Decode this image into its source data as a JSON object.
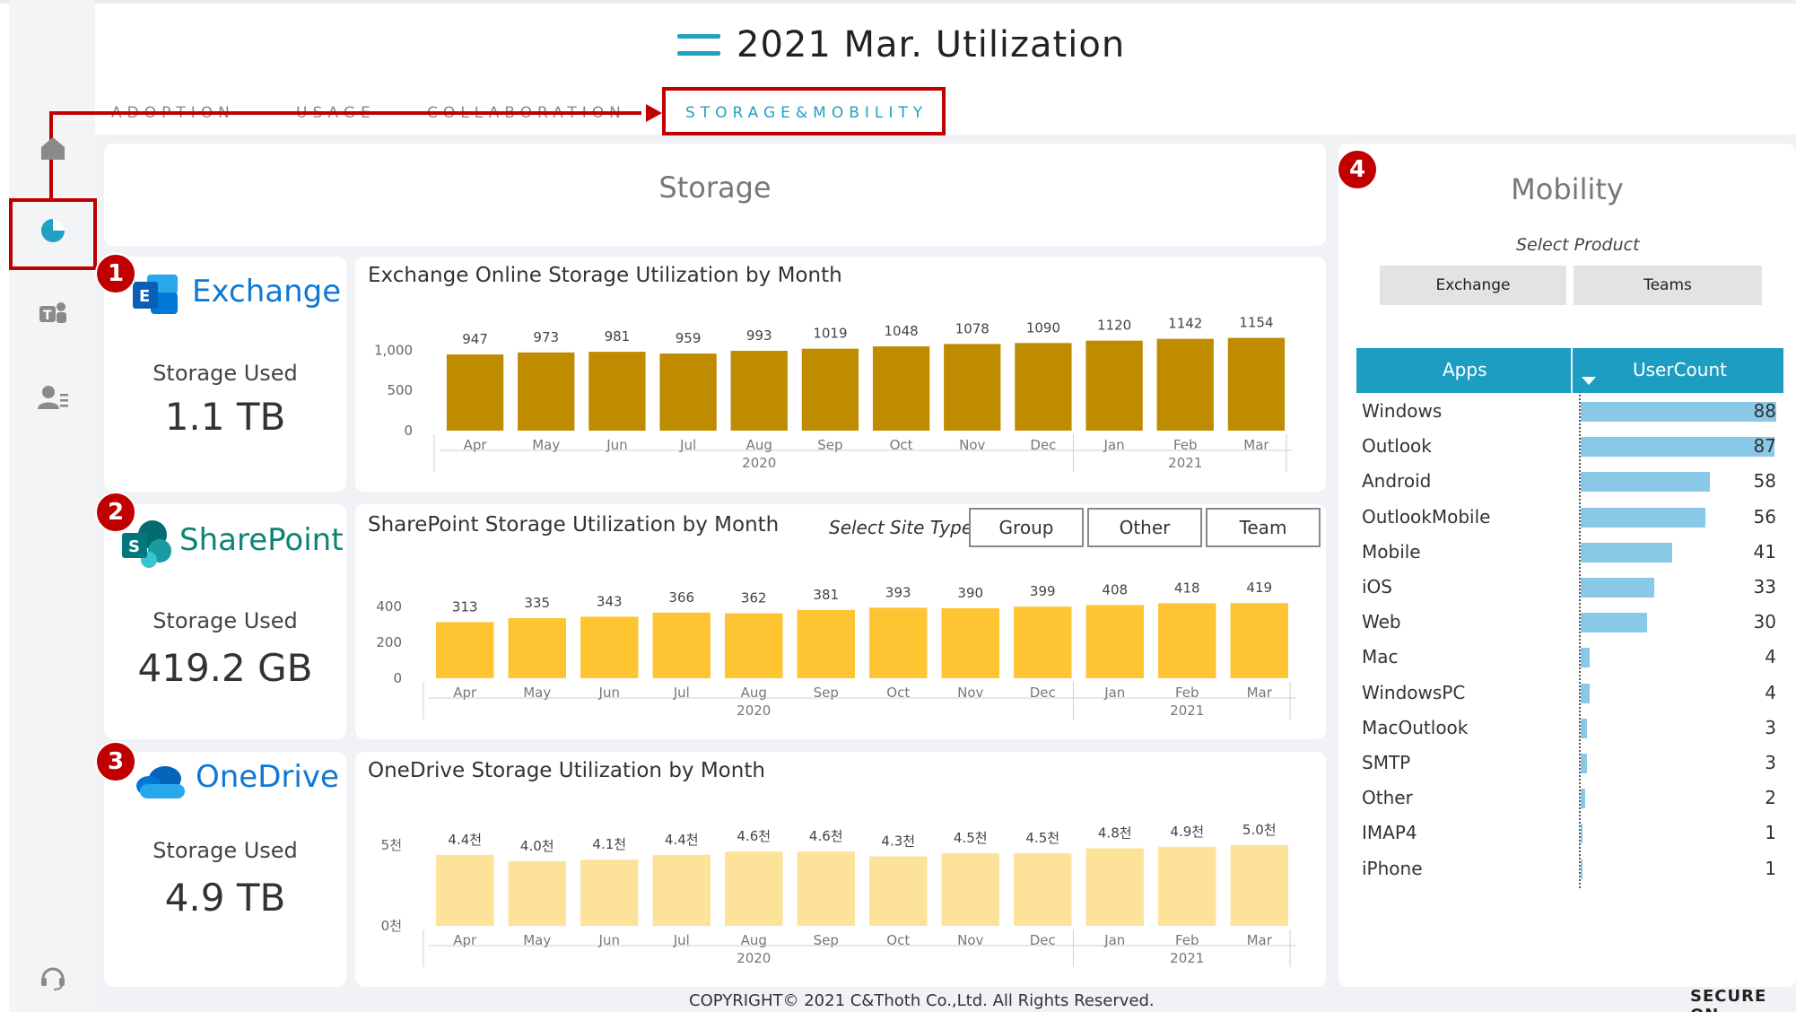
{
  "header": {
    "title": "2021 Mar. Utilization"
  },
  "tabs": [
    {
      "label": "ADOPTION"
    },
    {
      "label": "USAGE"
    },
    {
      "label": "COLLABORATION"
    },
    {
      "label": "STORAGE&MOBILITY",
      "active": true
    }
  ],
  "nav": [
    {
      "icon": "home-icon"
    },
    {
      "icon": "pie-chart-icon",
      "active": true
    },
    {
      "icon": "teams-icon"
    },
    {
      "icon": "user-list-icon"
    },
    {
      "icon": "headset-icon"
    }
  ],
  "callouts": [
    "1",
    "2",
    "3",
    "4"
  ],
  "storage": {
    "title": "Storage",
    "exchange": {
      "name": "Exchange",
      "label": "Storage Used",
      "value": "1.1 TB"
    },
    "sharepoint": {
      "name": "SharePoint",
      "label": "Storage Used",
      "value": "419.2 GB"
    },
    "onedrive": {
      "name": "OneDrive",
      "label": "Storage Used",
      "value": "4.9 TB"
    }
  },
  "site_type": {
    "label": "Select Site Type",
    "options": [
      "Group",
      "Other",
      "Team"
    ]
  },
  "mobility": {
    "title": "Mobility",
    "select_label": "Select Product",
    "products": [
      "Exchange",
      "Teams"
    ],
    "table": {
      "col_apps": "Apps",
      "col_users": "UserCount",
      "rows": [
        {
          "app": "Windows",
          "count": 88
        },
        {
          "app": "Outlook",
          "count": 87
        },
        {
          "app": "Android",
          "count": 58
        },
        {
          "app": "OutlookMobile",
          "count": 56
        },
        {
          "app": "Mobile",
          "count": 41
        },
        {
          "app": "iOS",
          "count": 33
        },
        {
          "app": "Web",
          "count": 30
        },
        {
          "app": "Mac",
          "count": 4
        },
        {
          "app": "WindowsPC",
          "count": 4
        },
        {
          "app": "MacOutlook",
          "count": 3
        },
        {
          "app": "SMTP",
          "count": 3
        },
        {
          "app": "Other",
          "count": 2
        },
        {
          "app": "IMAP4",
          "count": 1
        },
        {
          "app": "iPhone",
          "count": 1
        }
      ]
    }
  },
  "footer": {
    "copyright": "COPYRIGHT© 2021 C&Thoth Co.,Ltd. All Rights Reserved.",
    "logo": "SECURE ON"
  },
  "colors": {
    "accent": "#21a0c4",
    "callout": "#c00000",
    "exchange_bar": "#bf8c00",
    "sharepoint_bar": "#ffc431",
    "onedrive_bar": "#fde29a",
    "user_bar": "#89c8e6"
  },
  "chart_data": [
    {
      "type": "bar",
      "title": "Exchange Online Storage Utilization by Month",
      "categories": [
        "Apr",
        "May",
        "Jun",
        "Jul",
        "Aug",
        "Sep",
        "Oct",
        "Nov",
        "Dec",
        "Jan",
        "Feb",
        "Mar"
      ],
      "year_labels": {
        "Aug": "2020",
        "Feb": "2021"
      },
      "values": [
        947,
        973,
        981,
        959,
        993,
        1019,
        1048,
        1078,
        1090,
        1120,
        1142,
        1154
      ],
      "labels": [
        "947",
        "973",
        "981",
        "959",
        "993",
        "1019",
        "1048",
        "1078",
        "1090",
        "1120",
        "1142",
        "1154"
      ],
      "yticks": [
        "0",
        "500",
        "1,000"
      ],
      "ytick_values": [
        0,
        500,
        1000
      ],
      "ylim": [
        0,
        1250
      ],
      "color": "#bf8c00"
    },
    {
      "type": "bar",
      "title": "SharePoint Storage Utilization by Month",
      "categories": [
        "Apr",
        "May",
        "Jun",
        "Jul",
        "Aug",
        "Sep",
        "Oct",
        "Nov",
        "Dec",
        "Jan",
        "Feb",
        "Mar"
      ],
      "year_labels": {
        "Aug": "2020",
        "Feb": "2021"
      },
      "values": [
        313,
        335,
        343,
        366,
        362,
        381,
        393,
        390,
        399,
        408,
        418,
        419
      ],
      "labels": [
        "313",
        "335",
        "343",
        "366",
        "362",
        "381",
        "393",
        "390",
        "399",
        "408",
        "418",
        "419"
      ],
      "yticks": [
        "0",
        "200",
        "400"
      ],
      "ytick_values": [
        0,
        200,
        400
      ],
      "ylim": [
        0,
        500
      ],
      "color": "#ffc431"
    },
    {
      "type": "bar",
      "title": "OneDrive Storage Utilization by Month",
      "categories": [
        "Apr",
        "May",
        "Jun",
        "Jul",
        "Aug",
        "Sep",
        "Oct",
        "Nov",
        "Dec",
        "Jan",
        "Feb",
        "Mar"
      ],
      "year_labels": {
        "Aug": "2020",
        "Feb": "2021"
      },
      "values": [
        4400,
        4000,
        4100,
        4400,
        4600,
        4600,
        4300,
        4500,
        4500,
        4800,
        4900,
        5000
      ],
      "labels": [
        "4.4천",
        "4.0천",
        "4.1천",
        "4.4천",
        "4.6천",
        "4.6천",
        "4.3천",
        "4.5천",
        "4.5천",
        "4.8천",
        "4.9천",
        "5.0천"
      ],
      "yticks": [
        "0천",
        "5천"
      ],
      "ytick_values": [
        0,
        5000
      ],
      "ylim": [
        0,
        6000
      ],
      "color": "#fde29a"
    }
  ]
}
